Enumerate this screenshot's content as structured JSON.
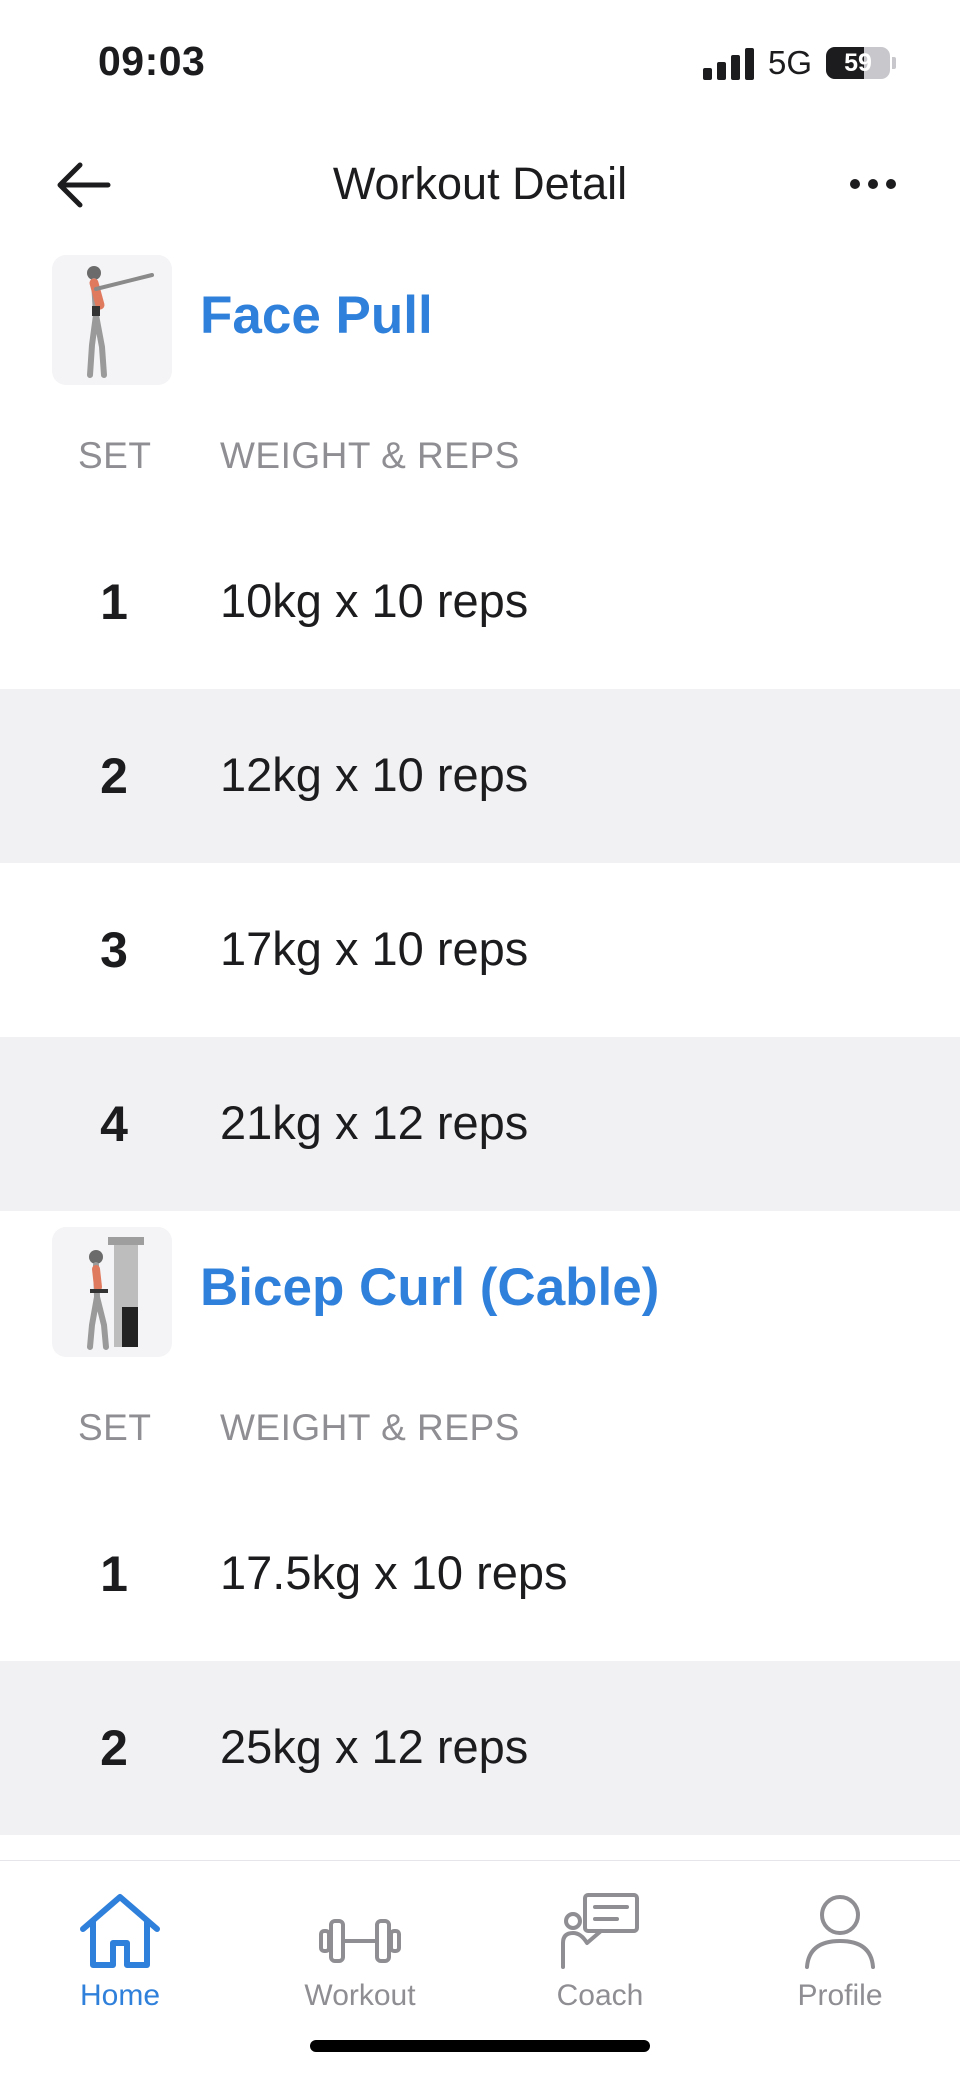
{
  "status_bar": {
    "time": "09:03",
    "network": "5G",
    "battery_level": "59",
    "battery_fraction": 0.59
  },
  "nav": {
    "title": "Workout Detail",
    "back_icon": "arrow-left-icon",
    "more_icon": "ellipsis-icon"
  },
  "columns": {
    "set": "SET",
    "weight_reps": "WEIGHT & REPS"
  },
  "exercises": [
    {
      "name": "Face Pull",
      "sets": [
        {
          "set": "1",
          "value": "10kg x 10 reps"
        },
        {
          "set": "2",
          "value": "12kg x 10 reps"
        },
        {
          "set": "3",
          "value": "17kg x 10 reps"
        },
        {
          "set": "4",
          "value": "21kg x 12 reps"
        }
      ]
    },
    {
      "name": "Bicep Curl (Cable)",
      "sets": [
        {
          "set": "1",
          "value": "17.5kg x 10 reps"
        },
        {
          "set": "2",
          "value": "25kg x 12 reps"
        }
      ]
    }
  ],
  "tabs": [
    {
      "label": "Home",
      "icon": "home-icon",
      "active": true
    },
    {
      "label": "Workout",
      "icon": "dumbbell-icon",
      "active": false
    },
    {
      "label": "Coach",
      "icon": "coach-icon",
      "active": false
    },
    {
      "label": "Profile",
      "icon": "profile-icon",
      "active": false
    }
  ],
  "colors": {
    "accent": "#2f80db",
    "row_alt": "#f1f1f4",
    "muted": "#8e8e93",
    "text": "#1c1c1e"
  }
}
